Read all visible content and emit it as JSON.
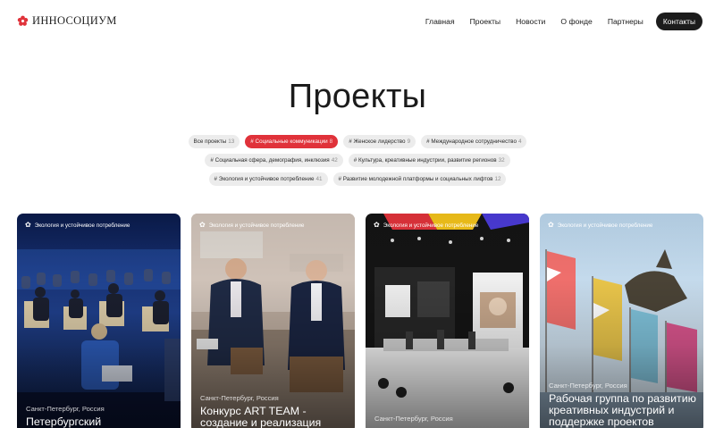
{
  "brand": {
    "name": "ИННОСОЦИУМ",
    "accent": "#e0323a"
  },
  "nav": {
    "items": [
      "Главная",
      "Проекты",
      "Новости",
      "О фонде",
      "Партнеры"
    ],
    "cta": "Контакты"
  },
  "page": {
    "title": "Проекты"
  },
  "filters": {
    "row1": [
      {
        "label": "Все проекты",
        "count": "13",
        "active": false
      },
      {
        "label": "# Социальные коммуникации",
        "count": "8",
        "active": true
      },
      {
        "label": "# Женское лидерство",
        "count": "9",
        "active": false
      },
      {
        "label": "# Международное сотрудничество",
        "count": "4",
        "active": false
      }
    ],
    "row2": [
      {
        "label": "# Социальная сфера, демография, инклюзия",
        "count": "42",
        "active": false
      },
      {
        "label": "# Культура, креативные индустрии, развитие регионов",
        "count": "32",
        "active": false
      }
    ],
    "row3": [
      {
        "label": "# Экология и устойчивое потребление",
        "count": "41",
        "active": false
      },
      {
        "label": "# Развитие молодежной платформы и социальных лифтов",
        "count": "12",
        "active": false
      }
    ]
  },
  "cards": [
    {
      "tag": "Экология и устойчивое потребление",
      "city": "Санкт-Петербург, Россия",
      "title": "Петербургский"
    },
    {
      "tag": "Экология и устойчивое потребление",
      "city": "Санкт-Петербург, Россия",
      "title": "Конкурс ART TEAM - создание и реализация"
    },
    {
      "tag": "Экология и устойчивое потребление",
      "city": "Санкт-Петербург, Россия",
      "title": ""
    },
    {
      "tag": "Экология и устойчивое потребление",
      "city": "Санкт-Петербург, Россия",
      "title": "Рабочая группа по развитию креативных индустрий и поддержке проектов"
    }
  ]
}
